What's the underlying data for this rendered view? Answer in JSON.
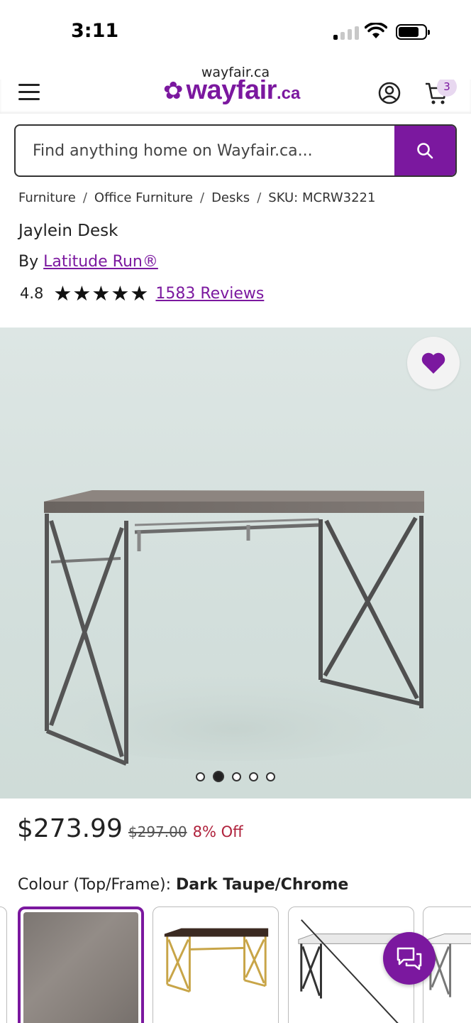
{
  "status_bar": {
    "time": "3:11"
  },
  "browser": {
    "url": "wayfair.ca"
  },
  "header": {
    "logo_text": "wayfair",
    "logo_suffix": ".ca",
    "cart_count": "3"
  },
  "search": {
    "placeholder": "Find anything home on Wayfair.ca..."
  },
  "breadcrumb": {
    "items": [
      "Furniture",
      "Office Furniture",
      "Desks"
    ],
    "separator": "/",
    "sku": "SKU: MCRW3221"
  },
  "product": {
    "title": "Jaylein Desk",
    "by_label": "By",
    "brand": "Latitude Run®",
    "rating": "4.8",
    "rating_value": 4.8,
    "reviews": "1583 Reviews",
    "price": "$273.99",
    "old_price": "$297.00",
    "discount": "8% Off",
    "colour_label": "Colour (Top/Frame):",
    "colour_value": "Dark Taupe/Chrome"
  },
  "gallery": {
    "image_count": 5,
    "active_index": 1
  },
  "colors": {
    "brand": "#7b189f",
    "discount": "#b0233d"
  },
  "icons": {
    "menu": "hamburger-icon",
    "account": "account-icon",
    "cart": "cart-icon",
    "search": "search-icon",
    "favorite": "heart-icon",
    "chat": "chat-icon"
  }
}
